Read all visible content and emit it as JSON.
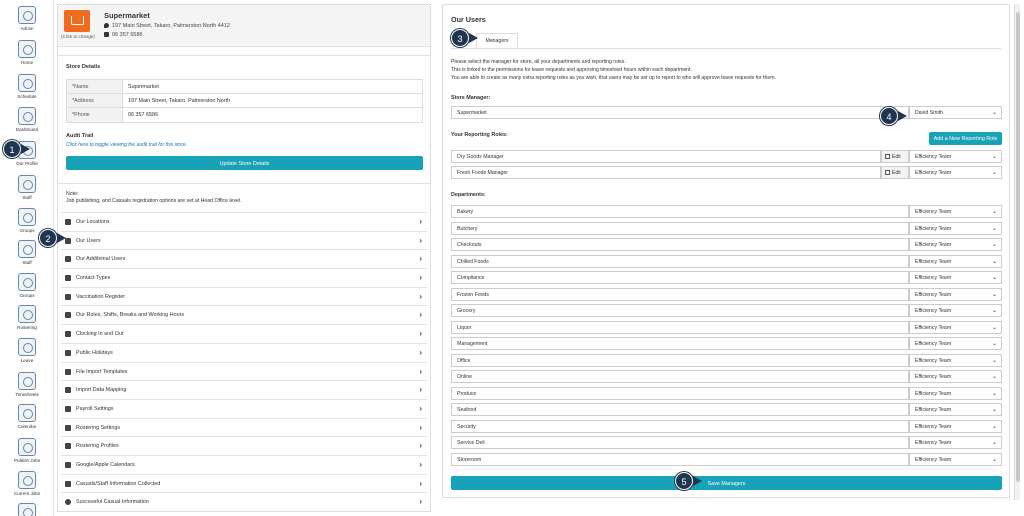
{
  "sidebar": {
    "items": [
      {
        "label": "Admin",
        "icon": "admin-icon"
      },
      {
        "label": "Home",
        "icon": "home-icon"
      },
      {
        "label": "Schedule",
        "icon": "schedule-icon"
      },
      {
        "label": "Dashboard",
        "icon": "dashboard-icon"
      },
      {
        "label": "Our Profile",
        "icon": "profile-icon"
      },
      {
        "label": "Staff",
        "icon": "staff-icon"
      },
      {
        "label": "Groups",
        "icon": "groups-icon"
      },
      {
        "label": "Staff",
        "icon": "staff-icon"
      },
      {
        "label": "Groups",
        "icon": "groups-icon"
      },
      {
        "label": "Rostering",
        "icon": "rostering-icon"
      },
      {
        "label": "Leave",
        "icon": "leave-icon"
      },
      {
        "label": "Timesheets",
        "icon": "timesheets-icon"
      },
      {
        "label": "Calendar",
        "icon": "calendar-icon"
      },
      {
        "label": "Publish Jobs",
        "icon": "publish-jobs-icon"
      },
      {
        "label": "Current Jobs",
        "icon": "current-jobs-icon"
      }
    ]
  },
  "store": {
    "name": "Supermarket",
    "address": "197 Main Street, Takaro, Palmerston North 4412",
    "phone": "06 357 6586",
    "logo_caption": "(Click to change)",
    "logo_color": "#f06b1e"
  },
  "store_details": {
    "title": "Store Details",
    "rows": [
      {
        "key": "*Name",
        "value": "Supermarket"
      },
      {
        "key": "*Address",
        "value": "197 Main Street, Takaro, Palmerston North"
      },
      {
        "key": "*Phone",
        "value": "06 357 6586"
      }
    ]
  },
  "audit": {
    "title": "Audit Trail",
    "link": "Click here to toggle viewing the audit trail for this store."
  },
  "update_button": "Update Store Details",
  "note": {
    "title": "Note:",
    "text": "Job publishing, and Casuals registration options are set at Head Office level."
  },
  "menu": [
    "Our Locations",
    "Our Users",
    "Our Additional Users",
    "Contact Types",
    "Vaccination Register",
    "Our Roles, Shifts, Breaks and Working Hours",
    "Clocking In and Out",
    "Public Holidays",
    "File Import Templates",
    "Import Data Mapping",
    "Payroll Settings",
    "Rostering Settings",
    "Rostering Profiles",
    "Google/Apple Calendars",
    "Casuals/Staff Information Collected",
    "Successful Casual Information"
  ],
  "users": {
    "title": "Our Users",
    "tab": "Managers",
    "desc": [
      "Please select the manager for store, all your departments and reporting roles.",
      "This is linked to the permissions for leave requests and approving timesheet hours within each department.",
      "You are able to create as many extra reporting roles as you wish, that users may be set up to report to who will approve leave requests for them."
    ],
    "store_manager_label": "Store Manager:",
    "store_manager_name": "Supermarket",
    "store_manager_value": "David Smith",
    "reporting_label": "Your Reporting Roles:",
    "add_role_button": "Add a New Reporting Role",
    "edit_label": "Edit",
    "reporting_roles": [
      {
        "name": "Dry Goods Manager",
        "value": "Efficiency Team"
      },
      {
        "name": "Fresh Foods Manager",
        "value": "Efficiency Team"
      }
    ],
    "departments_label": "Departments:",
    "departments": [
      {
        "name": "Bakery",
        "value": "Efficiency Team"
      },
      {
        "name": "Butchery",
        "value": "Efficiency Team"
      },
      {
        "name": "Checkouts",
        "value": "Efficiency Team"
      },
      {
        "name": "Chilled Foods",
        "value": "Efficiency Team"
      },
      {
        "name": "Compliance",
        "value": "Efficiency Team"
      },
      {
        "name": "Frozen Foods",
        "value": "Efficiency Team"
      },
      {
        "name": "Grocery",
        "value": "Efficiency Team"
      },
      {
        "name": "Liquor",
        "value": "Efficiency Team"
      },
      {
        "name": "Management",
        "value": "Efficiency Team"
      },
      {
        "name": "Office",
        "value": "Efficiency Team"
      },
      {
        "name": "Online",
        "value": "Efficiency Team"
      },
      {
        "name": "Produce",
        "value": "Efficiency Team"
      },
      {
        "name": "Seafood",
        "value": "Efficiency Team"
      },
      {
        "name": "Security",
        "value": "Efficiency Team"
      },
      {
        "name": "Service Deli",
        "value": "Efficiency Team"
      },
      {
        "name": "Storeroom",
        "value": "Efficiency Team"
      }
    ],
    "save_button": "Save Managers"
  },
  "callouts": [
    "1",
    "2",
    "3",
    "4",
    "5"
  ],
  "colors": {
    "accent": "#17a2b8",
    "callout": "#1f3550"
  }
}
